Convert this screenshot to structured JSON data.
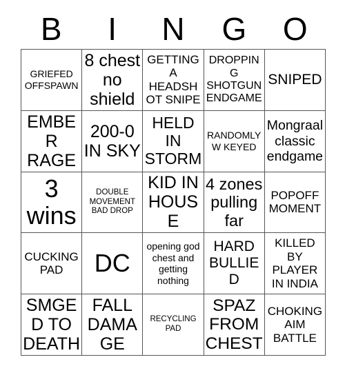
{
  "card": {
    "title": "BINGO",
    "header_letters": [
      "B",
      "I",
      "N",
      "G",
      "O"
    ],
    "grid_size": "5x5",
    "text_color": "#000000",
    "background_color": "#ffffff",
    "border_color": "#555555",
    "rows": [
      [
        {
          "text": "GRIEFED OFFSPAWN",
          "size": "sm",
          "column": "B",
          "row": 1
        },
        {
          "text": "8 chest no shield",
          "size": "xl",
          "column": "I",
          "row": 1
        },
        {
          "text": "GETTING A HEADSHOT SNIPE",
          "size": "md",
          "column": "N",
          "row": 1
        },
        {
          "text": "DROPPING SHOTGUN ENDGAME",
          "size": "md",
          "column": "G",
          "row": 1
        },
        {
          "text": "SNIPED",
          "size": "lg",
          "column": "O",
          "row": 1
        }
      ],
      [
        {
          "text": "EMBER RAGE",
          "size": "xl",
          "column": "B",
          "row": 2
        },
        {
          "text": "200-0 IN SKY",
          "size": "xl",
          "column": "I",
          "row": 2
        },
        {
          "text": "HELD IN STORM",
          "size": "xl",
          "column": "N",
          "row": 2
        },
        {
          "text": "RANDOMLY W KEYED",
          "size": "sm",
          "column": "G",
          "row": 2
        },
        {
          "text": "Mongraal classic endgame",
          "size": "lg",
          "column": "O",
          "row": 2
        }
      ],
      [
        {
          "text": "3 wins",
          "size": "xxl",
          "column": "B",
          "row": 3
        },
        {
          "text": "DOUBLE MOVEMENT BAD DROP",
          "size": "xs",
          "column": "I",
          "row": 3
        },
        {
          "text": "KID IN HOUSE",
          "size": "xl",
          "column": "N",
          "row": 3
        },
        {
          "text": "4 zones pulling far",
          "size": "xl",
          "column": "G",
          "row": 3
        },
        {
          "text": "POPOFF MOMENT",
          "size": "md",
          "column": "O",
          "row": 3
        }
      ],
      [
        {
          "text": "CUCKING PAD",
          "size": "md",
          "column": "B",
          "row": 4
        },
        {
          "text": "DC",
          "size": "xxl",
          "column": "I",
          "row": 4
        },
        {
          "text": "opening god chest and getting nothing",
          "size": "sm",
          "column": "N",
          "row": 4
        },
        {
          "text": "HARD BULLIED",
          "size": "lg",
          "column": "G",
          "row": 4
        },
        {
          "text": "KILLED BY PLAYER IN INDIA",
          "size": "md",
          "column": "O",
          "row": 4
        }
      ],
      [
        {
          "text": "SMGED TO DEATH",
          "size": "xl",
          "column": "B",
          "row": 5
        },
        {
          "text": "FALL DAMAGE",
          "size": "xl",
          "column": "I",
          "row": 5
        },
        {
          "text": "RECYCLING PAD",
          "size": "xs",
          "column": "N",
          "row": 5
        },
        {
          "text": "SPAZ FROM CHEST",
          "size": "xl",
          "column": "G",
          "row": 5
        },
        {
          "text": "CHOKING AIM BATTLE",
          "size": "md",
          "column": "O",
          "row": 5
        }
      ]
    ]
  }
}
